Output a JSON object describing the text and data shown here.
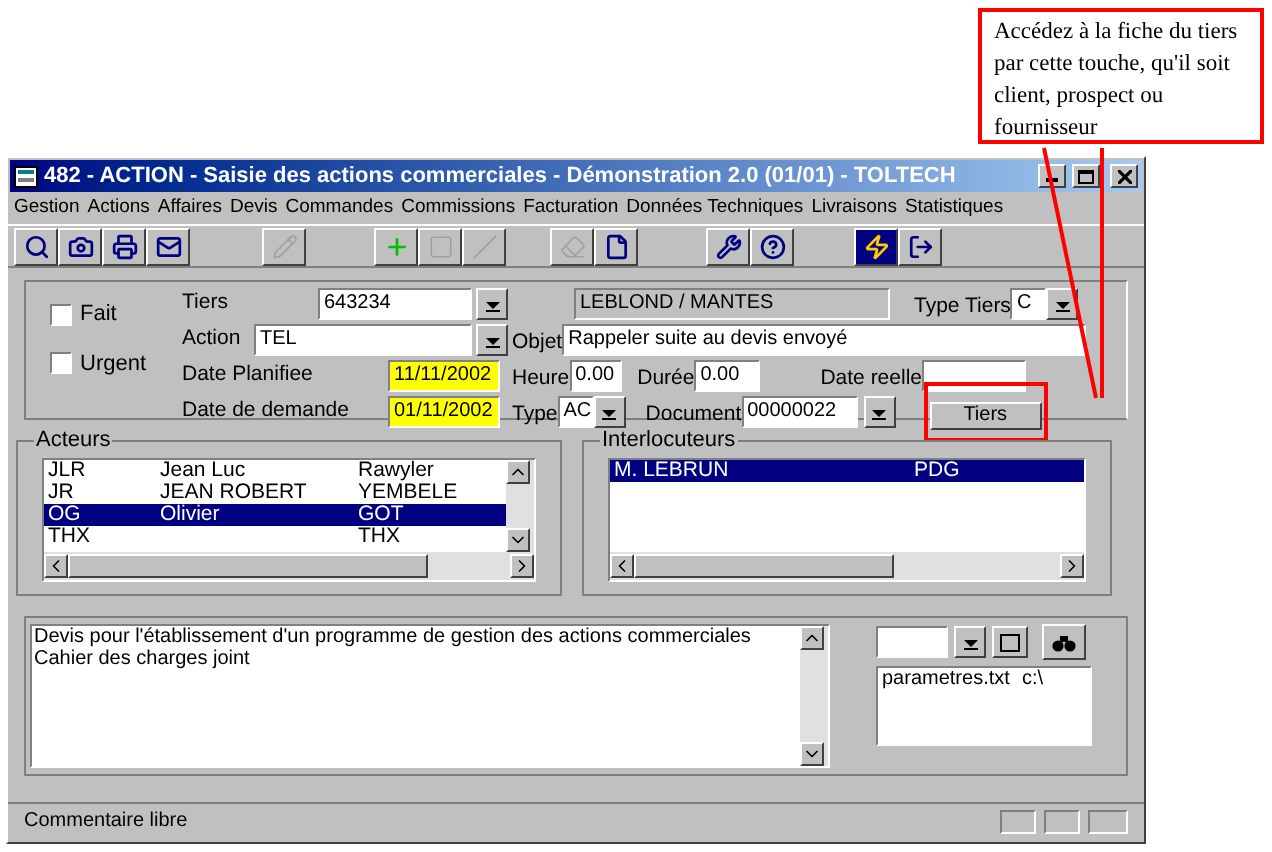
{
  "callout": "Accédez à la fiche du tiers par cette touche, qu'il soit client, prospect ou fournisseur",
  "window": {
    "title": "482 - ACTION - Saisie des actions commerciales - Démonstration 2.0 (01/01) - TOLTECH"
  },
  "menu": [
    "Gestion",
    "Actions",
    "Affaires",
    "Devis",
    "Commandes",
    "Commissions",
    "Facturation",
    "Données Techniques",
    "Livraisons",
    "Statistiques"
  ],
  "toolbar": [
    {
      "disabled": false
    },
    {
      "disabled": false
    },
    {
      "disabled": false
    },
    {
      "disabled": false
    },
    {
      "disabled": true
    },
    {
      "disabled": false
    },
    {
      "disabled": true
    },
    {
      "disabled": true
    },
    {
      "disabled": true
    },
    {
      "disabled": false
    },
    {
      "disabled": false
    },
    {
      "disabled": false
    },
    {
      "disabled": false
    },
    {
      "disabled": false
    }
  ],
  "form": {
    "checkboxes": [
      {
        "label": "Fait",
        "checked": false
      },
      {
        "label": "Urgent",
        "checked": false
      }
    ],
    "tiers": {
      "label": "Tiers",
      "value": "643234"
    },
    "tiers_name": "LEBLOND / MANTES",
    "type_tiers": {
      "label": "Type Tiers",
      "value": "C"
    },
    "action": {
      "label": "Action",
      "value": "TEL"
    },
    "objet": {
      "label": "Objet",
      "value": "Rappeler suite au devis envoyé"
    },
    "date_planifiee": {
      "label": "Date Planifiee",
      "value": "11/11/2002"
    },
    "heure": {
      "label": "Heure",
      "value": "0.00"
    },
    "duree": {
      "label": "Durée",
      "value": "0.00"
    },
    "date_reelle": {
      "label": "Date reelle"
    },
    "date_demande": {
      "label": "Date de demande",
      "value": "01/11/2002"
    },
    "type": {
      "label": "Type",
      "value": "AC"
    },
    "document": {
      "label": "Document",
      "value": "00000022"
    },
    "tiers_button": "Tiers"
  },
  "acteurs": {
    "title": "Acteurs",
    "rows": [
      {
        "code": "JLR",
        "first": "Jean Luc",
        "last": "Rawyler",
        "selected": false
      },
      {
        "code": "JR",
        "first": "JEAN ROBERT",
        "last": "YEMBELE",
        "selected": false
      },
      {
        "code": "OG",
        "first": "Olivier",
        "last": "GOT",
        "selected": true
      },
      {
        "code": "THX",
        "last": "THX",
        "selected": false
      }
    ]
  },
  "interlocuteurs": {
    "title": "Interlocuteurs",
    "rows": [
      {
        "name": "M. LEBRUN",
        "role": "PDG",
        "selected": true
      }
    ]
  },
  "comment": [
    "Devis pour l'établissement d'un programme de gestion des actions commerciales",
    "Cahier des charges joint"
  ],
  "files": [
    {
      "name": "parametres.txt",
      "path": "c:\\"
    }
  ],
  "status_bar": "Commentaire libre"
}
